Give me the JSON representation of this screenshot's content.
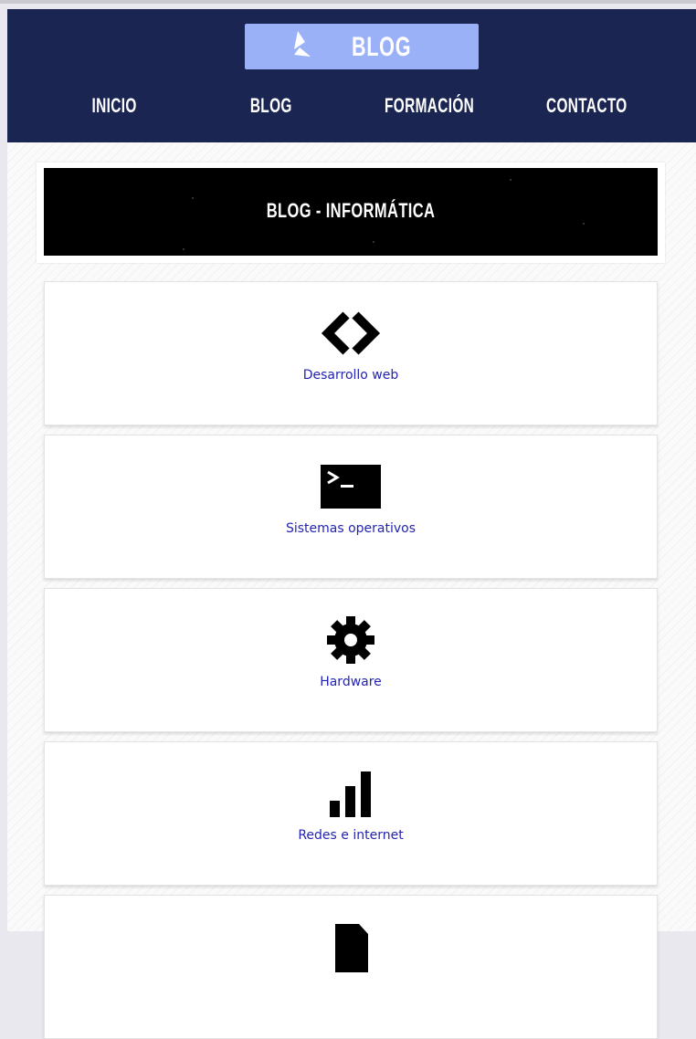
{
  "header": {
    "logo_text": "BLOG",
    "nav": [
      "INICIO",
      "BLOG",
      "FORMACIÓN",
      "CONTACTO"
    ]
  },
  "banner": {
    "title": "BLOG - INFORMÁTICA"
  },
  "categories": [
    {
      "label": "Desarrollo web",
      "icon": "code-icon"
    },
    {
      "label": "Sistemas operativos",
      "icon": "terminal-icon"
    },
    {
      "label": "Hardware",
      "icon": "gear-icon"
    },
    {
      "label": "Redes e internet",
      "icon": "signal-bars-icon"
    },
    {
      "label": "",
      "icon": "document-icon"
    }
  ],
  "colors": {
    "header_bg": "#1b2551",
    "logo_bg": "#9bb1f7",
    "link": "#2424b0"
  }
}
